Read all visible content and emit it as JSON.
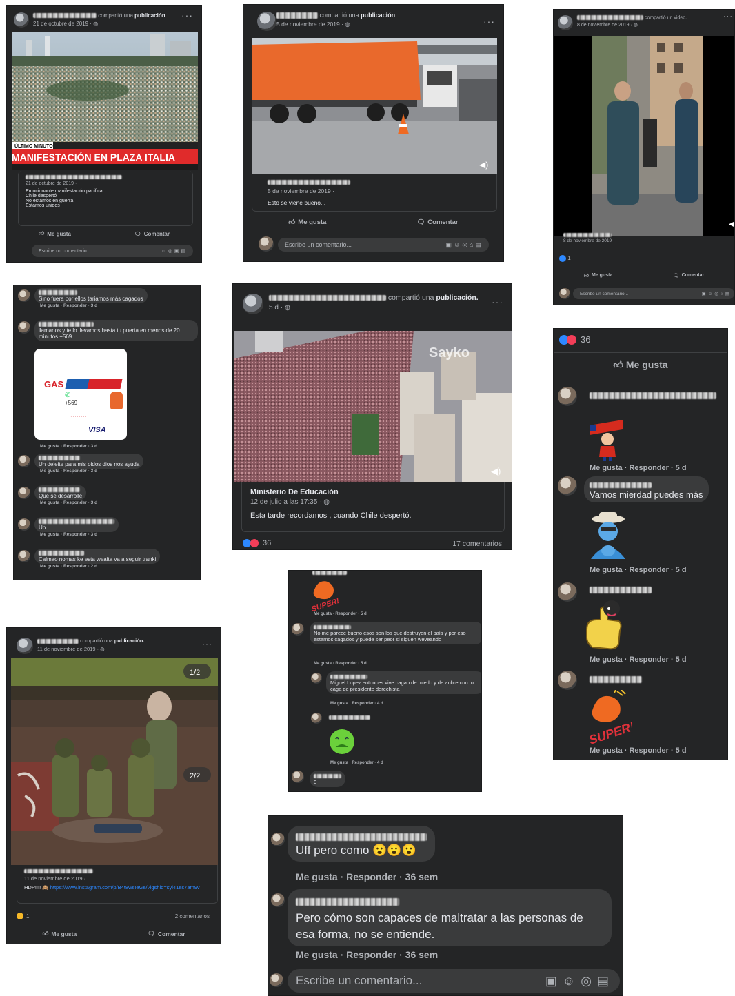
{
  "p1": {
    "header": {
      "action": "compartió una",
      "object": "publicación",
      "date": "21 de octubre de 2019 · "
    },
    "banner_tag": "ÚLTIMO MINUTO",
    "banner_title": "MANIFESTACIÓN EN PLAZA ITALIA",
    "shared_date": "21 de octubre de 2019 · ",
    "text_lines": [
      "Emocionante manifestación pacifica",
      "Chile despertó",
      "No estamos en guerra",
      "Estamos unidos"
    ],
    "like": "Me gusta",
    "comment": "Comentar",
    "input_placeholder": "Escribe un comentario..."
  },
  "p2": {
    "header": {
      "action": "compartió una",
      "object": "publicación",
      "date": "5 de noviembre de 2019 · "
    },
    "shared_date": "5 de noviembre de 2019 · ",
    "text": "Esto se viene bueno...",
    "like": "Me gusta",
    "comment": "Comentar",
    "input_placeholder": "Escribe un comentario..."
  },
  "p3": {
    "header": {
      "action": "compartió un",
      "object": "video.",
      "date": "8 de noviembre de 2019 · "
    },
    "shared_date": "8 de noviembre de 2019 · ",
    "reaction_count": "1",
    "like": "Me gusta",
    "comment": "Comentar",
    "input_placeholder": "Escribe un comentario..."
  },
  "p4": {
    "comments": [
      {
        "text": "Sino fuera por ellos tariamos más cagados",
        "acts": "Me gusta · Responder · 3 d"
      },
      {
        "text": "llamanos y te lo llevamos hasta tu puerta en menos de 20 minutos +569",
        "acts": "Me gusta · Responder · 3 d"
      },
      {
        "text": "Un deleite para mis oidos dios nos ayuda",
        "acts": "Me gusta · Responder · 3 d"
      },
      {
        "text": "Que se desarrolle",
        "acts": "Me gusta · Responder · 3 d"
      },
      {
        "text": "Up",
        "acts": "Me gusta · Responder · 3 d"
      },
      {
        "text": "Calmao nomas ke esta weaita va a seguir tranki",
        "acts": "Me gusta · Responder · 2 d"
      }
    ],
    "ad": {
      "brand": "GAS",
      "phone": "+569",
      "footer": "VISA"
    }
  },
  "p5": {
    "header": {
      "action": "compartió una",
      "object": "publicación.",
      "date": "5 d · "
    },
    "watermark": "Sayko",
    "source_name": "Ministerio De Educación",
    "source_date": "12 de julio a las 17:35 · ",
    "text": "Esta tarde recordamos , cuando Chile despertó.",
    "reaction_count": "36",
    "comments_count": "17 comentarios"
  },
  "p6": {
    "reaction_count": "36",
    "like": "Me gusta",
    "comments": [
      {
        "text": "",
        "acts": "Me gusta · Responder · 5 d",
        "sticker": "flag-sticker"
      },
      {
        "text": "Vamos mierdad puedes más",
        "acts": "Me gusta · Responder · 5 d",
        "sticker": "clap-man-sticker"
      },
      {
        "text": "",
        "acts": "Me gusta · Responder · 5 d",
        "sticker": "thumbs-up-sticker"
      },
      {
        "text": "",
        "acts": "Me gusta · Responder · 5 d",
        "sticker": "super-clap-sticker"
      }
    ],
    "super": "SUPER!"
  },
  "p7": {
    "super": "SUPER!",
    "comments": [
      {
        "text": "",
        "acts": "Me gusta · Responder · 5 d"
      },
      {
        "text": "No me parece bueno esos son los que destruyen el país y por eso estamos cagados y puede ser peor si siguen weveando",
        "acts": "Me gusta · Responder · 5 d"
      },
      {
        "text": "Miguel Lopez entonces vive cagao de miedo y de anbre con tu caga de presidente derechista",
        "acts": "Me gusta · Responder · 4 d"
      },
      {
        "text": "",
        "acts": "Me gusta · Responder · 4 d"
      },
      {
        "text": "0",
        "acts": ""
      }
    ]
  },
  "p8": {
    "header": {
      "action": "compartió una",
      "object": "publicación.",
      "date": "11 de noviembre de 2019 · "
    },
    "counter1": "1/2",
    "counter2": "2/2",
    "shared_date": "11 de noviembre de 2019 · ",
    "text": "HDP!!!! ",
    "link": "https://www.instagram.com/p/B4t8wsIeGe/?igshid=syi41es7am9v",
    "reaction_count": "1",
    "comments_count": "2 comentarios",
    "like": "Me gusta",
    "comment": "Comentar"
  },
  "p9": {
    "comments": [
      {
        "text": "Uff pero como 😮😮😮",
        "acts": "Me gusta · Responder · 36 sem"
      },
      {
        "text": "Pero cómo son capaces de maltratar a las personas de esa forma, no se entiende.",
        "acts": "Me gusta · Responder · 36 sem"
      }
    ],
    "input_placeholder": "Escribe un comentario..."
  },
  "colors": {
    "panel_bg": "#242526",
    "bubble_bg": "#3a3b3c",
    "accent": "#2d88ff",
    "banner_red": "#e02b2b"
  }
}
